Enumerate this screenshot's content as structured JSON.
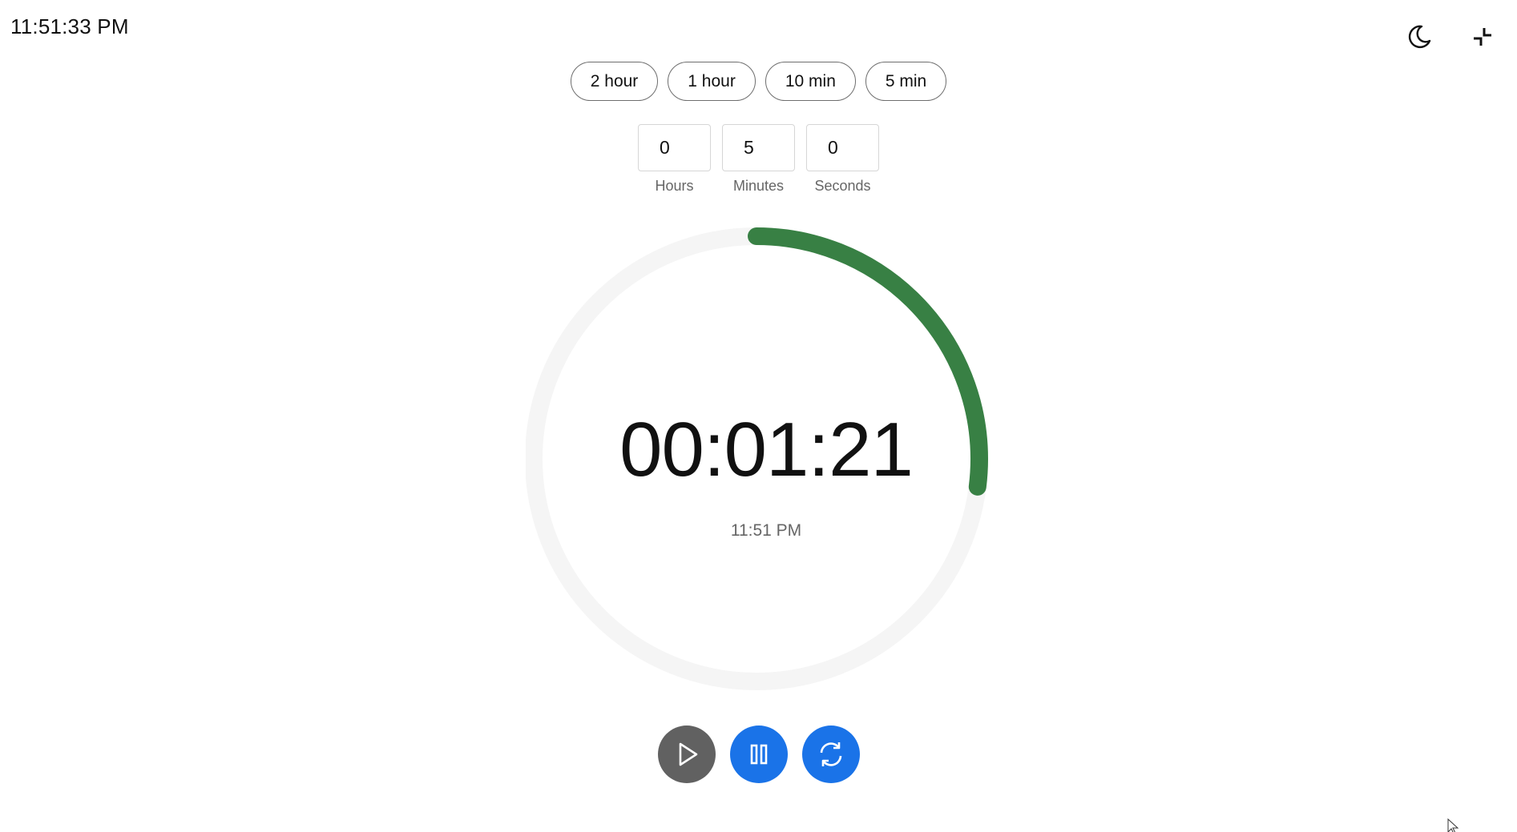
{
  "header": {
    "clock": "11:51:33 PM",
    "theme_icon": "moon-icon",
    "collapse_icon": "collapse-icon"
  },
  "presets": [
    {
      "label": "2 hour"
    },
    {
      "label": "1 hour"
    },
    {
      "label": "10 min"
    },
    {
      "label": "5 min"
    }
  ],
  "inputs": {
    "hours": {
      "value": "0",
      "label": "Hours"
    },
    "minutes": {
      "value": "5",
      "label": "Minutes"
    },
    "seconds": {
      "value": "0",
      "label": "Seconds"
    }
  },
  "timer": {
    "remaining": "00:01:21",
    "end_time": "11:51 PM",
    "progress_fraction": 0.27,
    "progress_color": "#388044",
    "track_color": "#f5f5f5"
  },
  "controls": {
    "play_icon": "play-icon",
    "pause_icon": "pause-icon",
    "reset_icon": "reset-icon",
    "play_color": "#616161",
    "accent_color": "#1a73e8"
  }
}
